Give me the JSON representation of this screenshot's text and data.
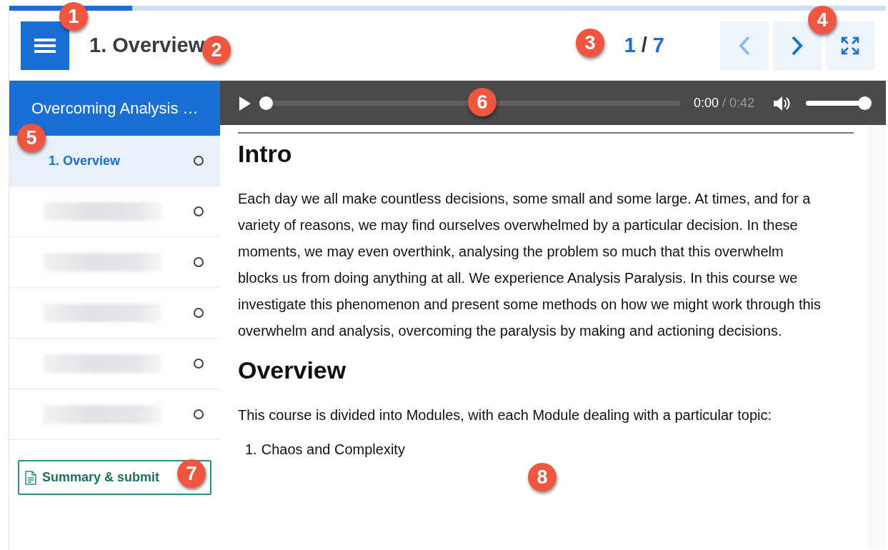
{
  "progress": {
    "level": 0.14
  },
  "header": {
    "title": "1. Overview",
    "page": "1",
    "separator": "/",
    "total": "7",
    "prev_disabled": true,
    "next_disabled": false
  },
  "sidebar": {
    "course_title": "Overcoming Analysis …",
    "items": [
      {
        "kind": "lesson",
        "label": "1. Overview",
        "selected": true,
        "completed": false
      },
      {
        "kind": "blurred",
        "selected": false,
        "completed": false
      },
      {
        "kind": "blurred",
        "selected": false,
        "completed": false
      },
      {
        "kind": "blurred",
        "selected": false,
        "completed": false
      },
      {
        "kind": "blurred",
        "selected": false,
        "completed": false
      },
      {
        "kind": "blurred",
        "selected": false,
        "completed": false
      }
    ],
    "submit_button": "Summary & submit"
  },
  "audio": {
    "playing": false,
    "position": {
      "level": 0
    },
    "current_time": "0:00",
    "duration": "/ 0:42",
    "volume": {
      "level": 1
    }
  },
  "content": [
    {
      "kind": "heading",
      "text": "Intro"
    },
    {
      "kind": "paragraph",
      "text": "Each day we all make countless decisions, some small and some large. At times, and for a variety of reasons, we may find ourselves overwhelmed by a particular decision. In these moments, we may even overthink, analysing the problem so much that this overwhelm blocks us from doing anything at all. We experience Analysis Paralysis. In this course we investigate this phenomenon and present some methods on how we might work through this overwhelm and analysis, overcoming the paralysis by making and actioning decisions."
    },
    {
      "kind": "heading",
      "text": "Overview"
    },
    {
      "kind": "paragraph",
      "text": "This course is divided into Modules, with each Module dealing with a particular topic:"
    },
    {
      "kind": "list",
      "items": [
        {
          "marker": "1.",
          "text": "Chaos and Complexity"
        }
      ]
    }
  ],
  "callouts": [
    "1",
    "2",
    "3",
    "4",
    "5",
    "6",
    "7",
    "8"
  ]
}
